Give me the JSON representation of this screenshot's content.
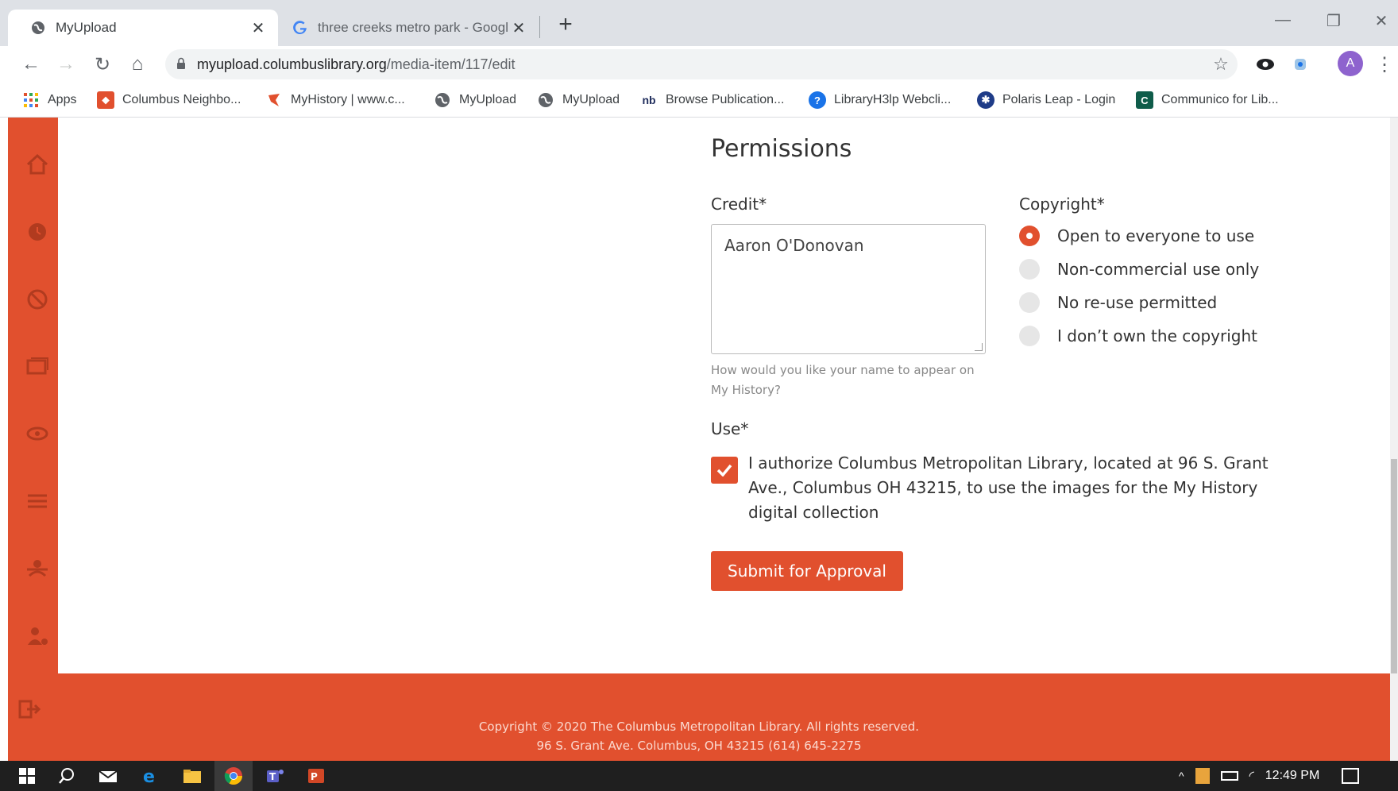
{
  "browser": {
    "tabs": [
      {
        "title": "MyUpload",
        "active": true,
        "icon": "globe-icon"
      },
      {
        "title": "three creeks metro park - Google",
        "active": false,
        "icon": "google-icon"
      }
    ],
    "url_domain": "myupload.columbuslibrary.org",
    "url_path": "/media-item/117/edit",
    "profile_initial": "A"
  },
  "bookmarks": [
    {
      "label": "Apps",
      "icon": "apps-grid-icon"
    },
    {
      "label": "Columbus Neighbo...",
      "icon": "map-pin-icon"
    },
    {
      "label": "MyHistory | www.c...",
      "icon": "myhistory-icon"
    },
    {
      "label": "MyUpload",
      "icon": "globe-icon"
    },
    {
      "label": "MyUpload",
      "icon": "globe-icon"
    },
    {
      "label": "Browse Publication...",
      "icon": "nb-icon"
    },
    {
      "label": "LibraryH3lp Webcli...",
      "icon": "help-bubble-icon"
    },
    {
      "label": "Polaris Leap - Login",
      "icon": "polaris-icon"
    },
    {
      "label": "Communico for Lib...",
      "icon": "communico-icon"
    }
  ],
  "sidebar_icons": [
    "home-icon",
    "clock-icon",
    "block-icon",
    "gallery-icon",
    "eye-icon",
    "menu-icon",
    "users-icon",
    "user-settings-icon",
    "logout-icon"
  ],
  "form": {
    "section_title": "Permissions",
    "credit_label": "Credit*",
    "credit_value": "Aaron O'Donovan",
    "credit_help": "How would you like your name to appear on My History?",
    "copyright_label": "Copyright*",
    "copyright_options": [
      {
        "label": "Open to everyone to use",
        "selected": true
      },
      {
        "label": "Non-commercial use only",
        "selected": false
      },
      {
        "label": "No re-use permitted",
        "selected": false
      },
      {
        "label": "I don’t own the copyright",
        "selected": false
      }
    ],
    "use_label": "Use*",
    "use_checked": true,
    "use_text": "I authorize Columbus Metropolitan Library, located at 96 S. Grant Ave., Columbus OH 43215, to use the images for the My History digital collection",
    "submit_label": "Submit for Approval"
  },
  "footer": {
    "line1": "Copyright © 2020 The Columbus Metropolitan Library. All rights reserved.",
    "line2": "96 S. Grant Ave. Columbus, OH 43215 (614) 645-2275"
  },
  "taskbar": {
    "clock": "12:49 PM"
  },
  "colors": {
    "accent": "#e1502e",
    "taskbar": "#1f1f1f"
  }
}
